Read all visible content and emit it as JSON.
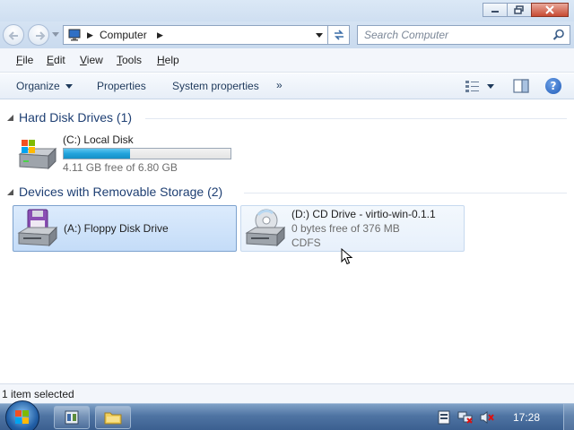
{
  "address": {
    "path": "Computer",
    "search_placeholder": "Search Computer"
  },
  "menu": {
    "items": [
      {
        "label": "File",
        "accel": "F"
      },
      {
        "label": "Edit",
        "accel": "E"
      },
      {
        "label": "View",
        "accel": "V"
      },
      {
        "label": "Tools",
        "accel": "T"
      },
      {
        "label": "Help",
        "accel": "H"
      }
    ]
  },
  "toolbar": {
    "organize": "Organize",
    "properties": "Properties",
    "system_properties": "System properties",
    "more": "»"
  },
  "groups": {
    "hdd": {
      "title": "Hard Disk Drives (1)",
      "drives": [
        {
          "name": "(C:) Local Disk",
          "free_text": "4.11 GB free of 6.80 GB",
          "used_fraction": 0.396
        }
      ]
    },
    "removable": {
      "title": "Devices with Removable Storage (2)",
      "drives": [
        {
          "name": "(A:) Floppy Disk Drive",
          "selected": true
        },
        {
          "name": "(D:) CD Drive - virtio-win-0.1.1",
          "free_text": "0 bytes free of 376 MB",
          "fs": "CDFS"
        }
      ]
    }
  },
  "status": {
    "text": "1 item selected"
  },
  "taskbar": {
    "clock": "17:28"
  },
  "colors": {
    "accent": "#1e3f73",
    "capacity": "#22a3dc",
    "selection": "#c4dcf8"
  }
}
